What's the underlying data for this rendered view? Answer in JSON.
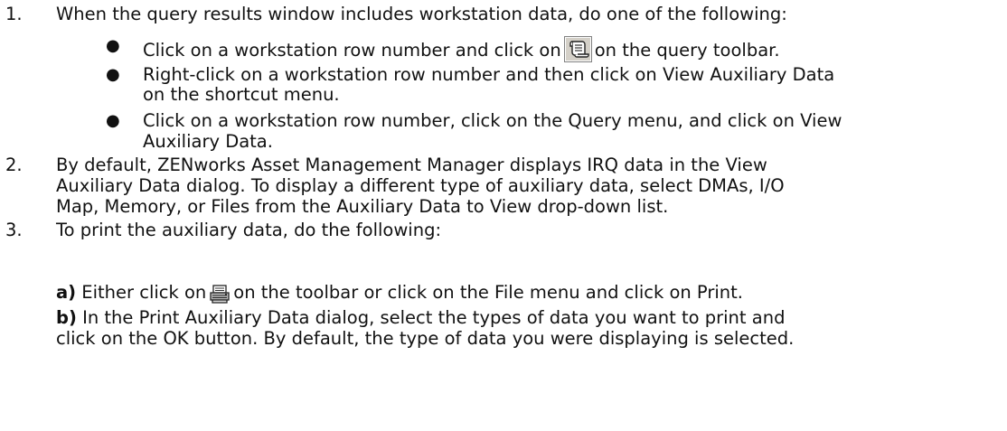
{
  "steps": [
    {
      "number": "1.",
      "text": "When the query results window includes workstation data, do one of the following:",
      "bullets": [
        {
          "before": "Click on a workstation row number and click on",
          "icon": "view-auxiliary-data-icon",
          "after": "on the query toolbar."
        },
        {
          "line1": "Right-click on a workstation row number and then click on View Auxiliary Data",
          "line2": "on the shortcut menu."
        },
        {
          "line1": "Click on a workstation row number, click on the Query menu, and click on View",
          "line2": "Auxiliary Data."
        }
      ]
    },
    {
      "number": "2.",
      "lines": [
        "By default, ZENworks Asset Management Manager displays IRQ data in the View",
        "Auxiliary Data dialog. To display a different type of auxiliary data, select DMAs, I/O",
        "Map, Memory, or Files from the Auxiliary Data to View drop-down list."
      ]
    },
    {
      "number": "3.",
      "text": "To print the auxiliary data, do the following:",
      "substeps": [
        {
          "label": "a)",
          "before": "Either click on",
          "icon": "print-icon",
          "after": "on the toolbar or click on the File menu and click on Print."
        },
        {
          "label": "b)",
          "line1": "In the Print Auxiliary Data dialog, select the types of data you want to print and",
          "line2": "click on the OK button. By default, the type of data you were displaying is selected."
        }
      ]
    }
  ]
}
